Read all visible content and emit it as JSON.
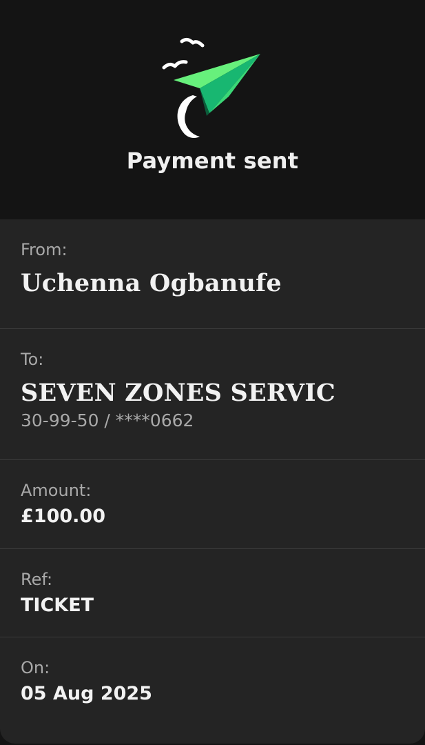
{
  "header": {
    "title": "Payment sent",
    "icon": "paper-plane-with-birds-icon",
    "accent_color": "#5fee7a"
  },
  "details": {
    "from": {
      "label": "From:",
      "value": "Uchenna Ogbanufe"
    },
    "to": {
      "label": "To:",
      "value": "SEVEN ZONES SERVIC",
      "account": "30-99-50 / ****0662"
    },
    "amount": {
      "label": "Amount:",
      "value": "£100.00"
    },
    "ref": {
      "label": "Ref:",
      "value": "TICKET"
    },
    "on": {
      "label": "On:",
      "value": "05 Aug 2025"
    }
  }
}
